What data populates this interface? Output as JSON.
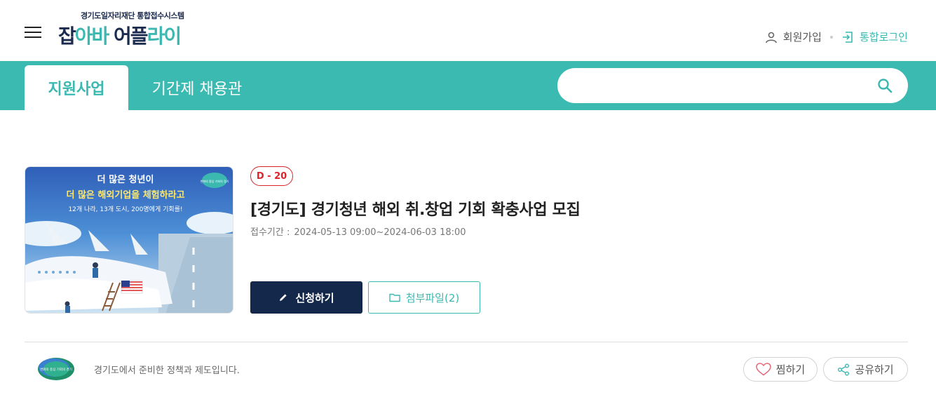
{
  "header": {
    "logo_sub": "경기도일자리재단 통합접수시스템",
    "logo_main_a": "잡",
    "logo_main_b": "아바 ",
    "logo_main_c": "어플",
    "logo_main_d": "라이",
    "join_label": "회원가입",
    "login_label": "통합로그인"
  },
  "nav": {
    "tabs": [
      {
        "label": "지원사업",
        "active": true
      },
      {
        "label": "기간제 채용관",
        "active": false
      }
    ],
    "search": {
      "placeholder": "",
      "value": ""
    }
  },
  "post": {
    "dday": "D - 20",
    "title": "[경기도] 경기청년 해외 취.창업 기회 확충사업 모집",
    "period_label": "접수기간 :",
    "period_value": "2024-05-13 09:00~2024-06-03 18:00",
    "apply_label": "신청하기",
    "files_label": "첨부파일(2)",
    "thumbnail": {
      "line1": "더 많은 청년이",
      "line2": "더 많은 해외기업을 체험하라고",
      "line3": "12개 나라, 13개 도시, 200명에게 기회를!",
      "badge": "변화의 중심 기회의 경기"
    }
  },
  "footer": {
    "org_logo_text": "변화의 중심 기회의 경기",
    "org_text": "경기도에서 준비한 정책과 제도입니다.",
    "like_label": "찜하기",
    "share_label": "공유하기"
  },
  "colors": {
    "teal": "#3bbab2",
    "navy": "#14284b",
    "dday_red": "#d9252b"
  }
}
